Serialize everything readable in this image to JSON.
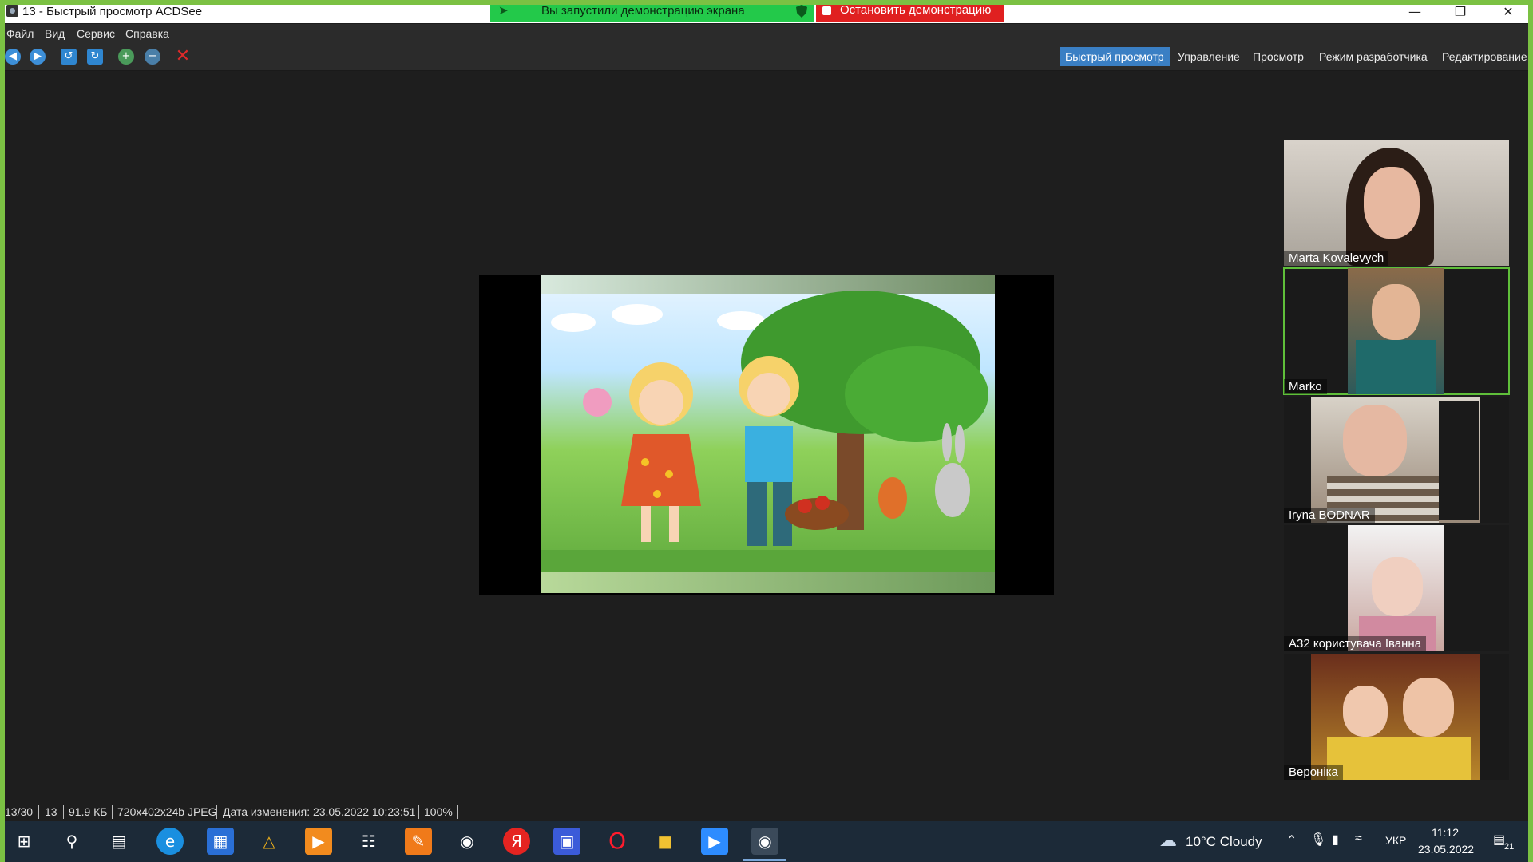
{
  "window": {
    "title": "13 - Быстрый просмотр ACDSee",
    "min_icon": "minimize-icon",
    "max_icon": "restore-icon",
    "close_icon": "close-icon"
  },
  "share": {
    "banner_text": "Вы запустили демонстрацию экрана",
    "stop_label": "Остановить демонстрацию",
    "banner_color": "#23c94a",
    "stop_color": "#e02020"
  },
  "menu": [
    "Файл",
    "Вид",
    "Сервис",
    "Справка"
  ],
  "toolbar": {
    "icons": [
      "back-icon",
      "forward-icon",
      "rotate-left-icon",
      "rotate-right-icon",
      "zoom-in-icon",
      "zoom-out-icon",
      "delete-icon"
    ],
    "modes": [
      "Быстрый просмотр",
      "Управление",
      "Просмотр",
      "Режим разработчика",
      "Редактирование"
    ],
    "active_mode": "Быстрый просмотр"
  },
  "participants": [
    {
      "name": "Marta Kovalevych"
    },
    {
      "name": "Marko"
    },
    {
      "name": "Iryna BODNAR"
    },
    {
      "name": "A32 користувача Іванна"
    },
    {
      "name": "Вероніка"
    }
  ],
  "status": {
    "index": "13/30",
    "number": "13",
    "size": "91.9 КБ",
    "dims": "720x402x24b JPEG",
    "modified": "Дата изменения: 23.05.2022 10:23:51",
    "zoom": "100%"
  },
  "taskbar": {
    "weather": "10°C  Cloudy",
    "lang": "УКР",
    "time": "11:12",
    "date": "23.05.2022",
    "notifications": "21"
  }
}
